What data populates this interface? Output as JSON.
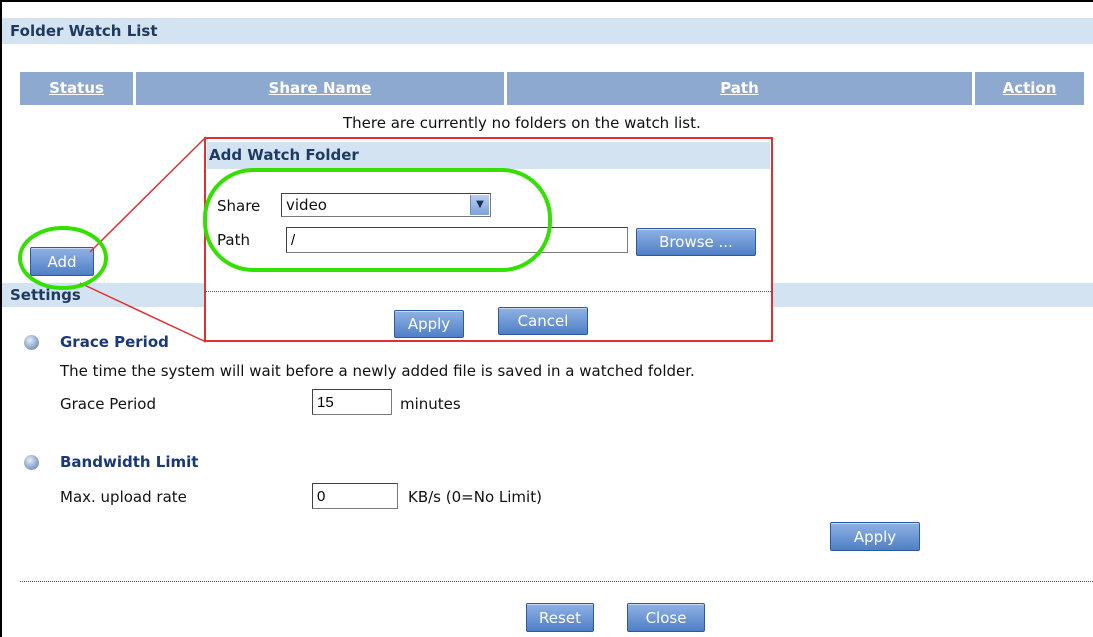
{
  "watch_list": {
    "title": "Folder Watch List",
    "columns": [
      "Status",
      "Share Name",
      "Path",
      "Action"
    ],
    "empty_message": "There are currently no folders on the watch list.",
    "add_label": "Add"
  },
  "dialog": {
    "title": "Add Watch Folder",
    "share_label": "Share",
    "share_value": "video",
    "path_label": "Path",
    "path_value": "/",
    "browse_label": "Browse ...",
    "apply_label": "Apply",
    "cancel_label": "Cancel"
  },
  "settings": {
    "title": "Settings",
    "grace": {
      "heading": "Grace Period",
      "description": "The time the system will wait before a newly added file is saved in a watched folder.",
      "label": "Grace Period",
      "value": "15",
      "unit": "minutes"
    },
    "bandwidth": {
      "heading": "Bandwidth Limit",
      "label": "Max. upload rate",
      "value": "0",
      "unit": "KB/s (0=No Limit)"
    },
    "apply_label": "Apply"
  },
  "footer": {
    "reset_label": "Reset",
    "close_label": "Close"
  },
  "colors": {
    "section_bar": "#d4e3f2",
    "table_header": "#8ea9d0",
    "button": "#5a8bd0",
    "callout_red": "#e03030",
    "highlight_green": "#33e000"
  }
}
